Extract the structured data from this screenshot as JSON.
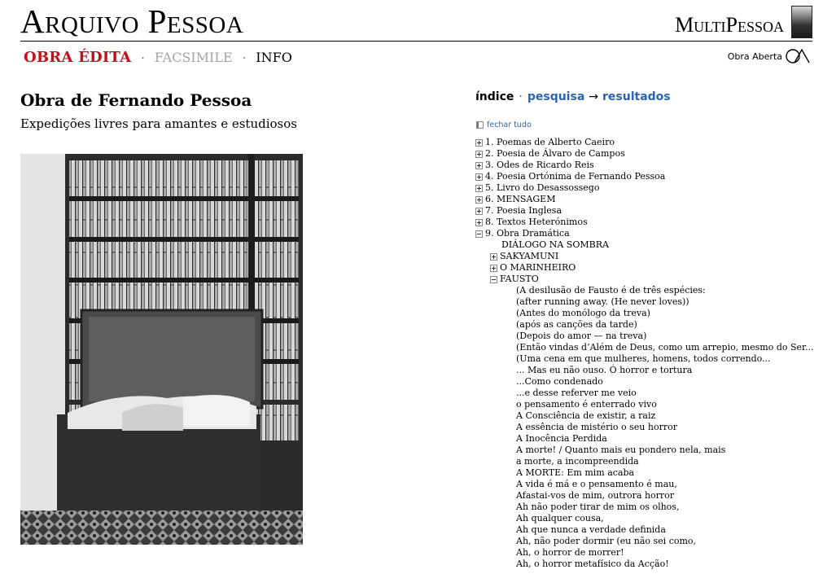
{
  "header": {
    "site_title": "Arquivo Pessoa",
    "multipessoa": "MultiPessoa"
  },
  "nav": {
    "obra_edita": "OBRA ÉDITA",
    "facsimile": "FACSIMILE",
    "info": "INFO",
    "separator": "·"
  },
  "obra_aberta": "Obra Aberta",
  "main": {
    "title": "Obra de Fernando Pessoa",
    "subtitle": "Expedições livres para amantes e estudiosos"
  },
  "index_nav": {
    "indice": "índice",
    "separator": "·",
    "pesquisa": "pesquisa",
    "arrow": "→",
    "resultados": "resultados"
  },
  "collapse_all": "fechar tudo",
  "tree": {
    "top": [
      "1. Poemas de Alberto Caeiro",
      "2. Poesia de Álvaro de Campos",
      "3. Odes de Ricardo Reis",
      "4. Poesia Ortónima de Fernando Pessoa",
      "5. Livro do Desassossego",
      "6. MENSAGEM",
      "7. Poesia Inglesa",
      "8. Textos Heterónimos",
      "9. Obra Dramática"
    ],
    "dramatica": [
      "DIÁLOGO NA SOMBRA",
      "SAKYAMUNI",
      "O MARINHEIRO",
      "FAUSTO"
    ],
    "fausto": [
      "(A desilusão de Fausto é de três espécies:",
      "(after running away. (He never loves))",
      "(Antes do monólogo da treva)",
      "(após as canções da tarde)",
      "(Depois do amor — na treva)",
      "(Então vindas d’Além de Deus, como um arrepio, mesmo do Ser...",
      "(Uma cena em que mulheres, homens, todos correndo...",
      "... Mas eu não ouso. Ó horror e tortura",
      "...Como condenado",
      "...e desse referver me veio",
      "o pensamento é enterrado vivo",
      "A Consciência de existir, a raiz",
      "A essência de mistério o seu horror",
      "A Inocência Perdida",
      "A morte! / Quanto mais eu pondero nela, mais",
      "a morte, a incompreendida",
      "A MORTE: Em mim acaba",
      "A vida é má e o pensamento é mau,",
      "Afastai-vos de mim, outrora horror",
      "Ah não poder tirar de mim os olhos,",
      "Ah qualquer cousa,",
      "Ah que nunca a verdade definida",
      "Ah, não poder dormir (eu não sei como,",
      "Ah, o horror de morrer!",
      "Ah, o horror metafísico da Acção!"
    ]
  }
}
